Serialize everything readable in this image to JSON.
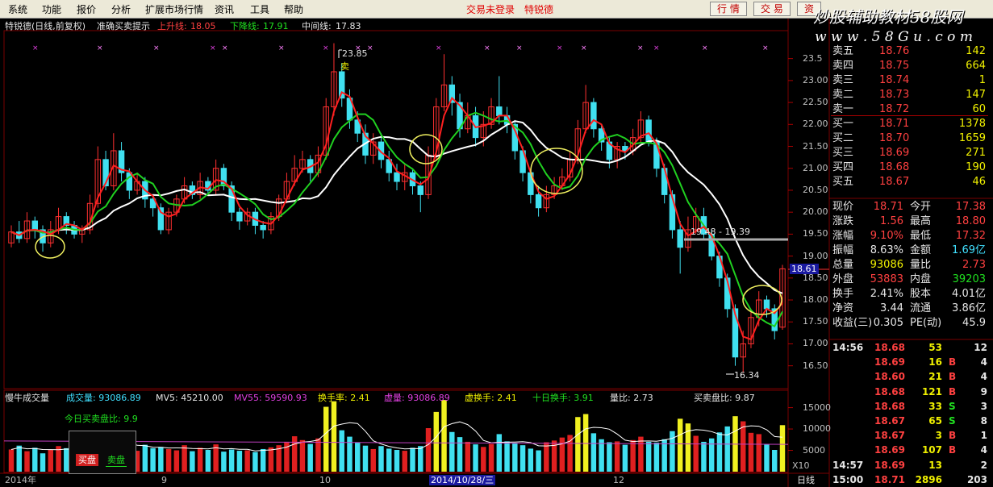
{
  "menu": {
    "items": [
      "系统",
      "功能",
      "报价",
      "分析",
      "扩展市场行情",
      "资讯",
      "工具",
      "帮助"
    ],
    "status": [
      "交易未登录",
      "特锐德"
    ],
    "buttons": [
      "行 情",
      "交 易",
      "资"
    ]
  },
  "watermark": {
    "line1": "炒股辅助教材58股网",
    "line2": "w w w . 5 8 G u . c o m"
  },
  "main_header": {
    "stock": "特锐德(日线,前复权)",
    "indicator": "准确买卖提示",
    "upper_label": "上升线:",
    "upper_value": "18.05",
    "lower_label": "下降线:",
    "lower_value": "17.91",
    "mid_label": "中间线:",
    "mid_value": "17.83"
  },
  "annotations": {
    "high": "23.85",
    "low": "16.34",
    "band": "19.48 - 19.39",
    "sell_signal": "卖",
    "current_price_tag": "18.61",
    "date_cursor": "2014/10/28/三",
    "period": "日线",
    "scale": "X10"
  },
  "price_axis": [
    "23.5",
    "23.00",
    "22.50",
    "22.00",
    "21.50",
    "21.00",
    "20.50",
    "20.00",
    "19.50",
    "19.00",
    "18.50",
    "18.00",
    "17.50",
    "17.00",
    "16.50"
  ],
  "volume_axis": [
    "15000",
    "10000",
    "5000"
  ],
  "date_axis": [
    "2014年",
    "9",
    "10",
    "12"
  ],
  "volume_header": {
    "name": "慢牛成交量",
    "vol": "成交量: 93086.89",
    "mv5": "MV5: 45210.00",
    "mv55": "MV55: 59590.93",
    "turnover": "换手率: 2.41",
    "virtual_vol": "虚量: 93086.89",
    "virtual_turn": "虚换手: 2.41",
    "ten_day": "十日换手: 3.91",
    "vol_ratio": "量比: 2.73",
    "bs_ratio": "买卖盘比: 9.87",
    "today_ratio": "今日买卖盘比: 9.9",
    "buy_btn": "买盘",
    "sell_btn": "卖盘"
  },
  "order_book": [
    {
      "label": "卖五",
      "price": "18.76",
      "qty": "142"
    },
    {
      "label": "卖四",
      "price": "18.75",
      "qty": "664"
    },
    {
      "label": "卖三",
      "price": "18.74",
      "qty": "1"
    },
    {
      "label": "卖二",
      "price": "18.73",
      "qty": "147"
    },
    {
      "label": "卖一",
      "price": "18.72",
      "qty": "60"
    },
    {
      "label": "买一",
      "price": "18.71",
      "qty": "1378"
    },
    {
      "label": "买二",
      "price": "18.70",
      "qty": "1659"
    },
    {
      "label": "买三",
      "price": "18.69",
      "qty": "271"
    },
    {
      "label": "买四",
      "price": "18.68",
      "qty": "190"
    },
    {
      "label": "买五",
      "price": "18.67",
      "qty": "46"
    }
  ],
  "quote": [
    {
      "l1": "现价",
      "v1": "18.71",
      "l2": "今开",
      "v2": "17.38"
    },
    {
      "l1": "涨跌",
      "v1": "1.56",
      "l2": "最高",
      "v2": "18.80"
    },
    {
      "l1": "涨幅",
      "v1": "9.10%",
      "l2": "最低",
      "v2": "17.32"
    },
    {
      "l1": "振幅",
      "v1": "8.63%",
      "l2": "金额",
      "v2": "1.69亿"
    },
    {
      "l1": "总量",
      "v1": "93086",
      "l2": "量比",
      "v2": "2.73"
    },
    {
      "l1": "外盘",
      "v1": "53883",
      "l2": "内盘",
      "v2": "39203"
    },
    {
      "l1": "换手",
      "v1": "2.41%",
      "l2": "股本",
      "v2": "4.01亿"
    },
    {
      "l1": "净资",
      "v1": "3.44",
      "l2": "流通",
      "v2": "3.86亿"
    },
    {
      "l1": "收益(三)",
      "v1": "0.305",
      "l2": "PE(动)",
      "v2": "45.9"
    }
  ],
  "ticks": [
    {
      "time": "14:56",
      "price": "18.68",
      "qty": "53",
      "flag": "",
      "n": "12"
    },
    {
      "time": "",
      "price": "18.69",
      "qty": "16",
      "flag": "B",
      "n": "4"
    },
    {
      "time": "",
      "price": "18.60",
      "qty": "21",
      "flag": "B",
      "n": "4"
    },
    {
      "time": "",
      "price": "18.68",
      "qty": "121",
      "flag": "B",
      "n": "9"
    },
    {
      "time": "",
      "price": "18.68",
      "qty": "33",
      "flag": "S",
      "n": "3"
    },
    {
      "time": "",
      "price": "18.67",
      "qty": "65",
      "flag": "S",
      "n": "8"
    },
    {
      "time": "",
      "price": "18.67",
      "qty": "3",
      "flag": "B",
      "n": "1"
    },
    {
      "time": "",
      "price": "18.69",
      "qty": "107",
      "flag": "B",
      "n": "4"
    },
    {
      "time": "14:57",
      "price": "18.69",
      "qty": "13",
      "flag": "",
      "n": "2"
    },
    {
      "time": "15:00",
      "price": "18.71",
      "qty": "2896",
      "flag": "",
      "n": "203"
    }
  ],
  "chart_data": {
    "type": "candlestick",
    "title": "特锐德(日线,前复权)",
    "price_range": [
      16.2,
      24.1
    ],
    "volume_range": [
      0,
      17000
    ],
    "candles": [
      {
        "o": 19.3,
        "c": 19.55,
        "h": 19.7,
        "l": 19.2
      },
      {
        "o": 19.55,
        "c": 19.4,
        "h": 19.8,
        "l": 19.3
      },
      {
        "o": 19.4,
        "c": 19.8,
        "h": 20.0,
        "l": 19.3
      },
      {
        "o": 19.8,
        "c": 19.6,
        "h": 19.9,
        "l": 19.4
      },
      {
        "o": 19.6,
        "c": 19.3,
        "h": 19.7,
        "l": 19.1
      },
      {
        "o": 19.3,
        "c": 19.6,
        "h": 19.8,
        "l": 19.2
      },
      {
        "o": 19.6,
        "c": 19.9,
        "h": 20.1,
        "l": 19.5
      },
      {
        "o": 19.9,
        "c": 19.7,
        "h": 20.0,
        "l": 19.5
      },
      {
        "o": 19.7,
        "c": 19.5,
        "h": 19.8,
        "l": 19.4
      },
      {
        "o": 19.5,
        "c": 19.6,
        "h": 19.7,
        "l": 19.3
      },
      {
        "o": 19.6,
        "c": 20.2,
        "h": 20.4,
        "l": 19.5
      },
      {
        "o": 20.2,
        "c": 21.2,
        "h": 21.5,
        "l": 20.1
      },
      {
        "o": 21.2,
        "c": 20.6,
        "h": 21.4,
        "l": 20.5
      },
      {
        "o": 20.6,
        "c": 21.4,
        "h": 21.8,
        "l": 20.5
      },
      {
        "o": 21.4,
        "c": 20.9,
        "h": 21.6,
        "l": 20.7
      },
      {
        "o": 20.9,
        "c": 20.5,
        "h": 21.0,
        "l": 20.3
      },
      {
        "o": 20.5,
        "c": 20.7,
        "h": 20.9,
        "l": 20.4
      },
      {
        "o": 20.7,
        "c": 20.3,
        "h": 20.8,
        "l": 20.1
      },
      {
        "o": 20.3,
        "c": 20.1,
        "h": 20.4,
        "l": 19.9
      },
      {
        "o": 20.1,
        "c": 19.6,
        "h": 20.2,
        "l": 19.5
      },
      {
        "o": 19.6,
        "c": 20.0,
        "h": 20.1,
        "l": 19.5
      },
      {
        "o": 20.0,
        "c": 20.3,
        "h": 20.4,
        "l": 19.9
      },
      {
        "o": 20.3,
        "c": 20.6,
        "h": 20.8,
        "l": 20.2
      },
      {
        "o": 20.6,
        "c": 20.4,
        "h": 20.7,
        "l": 20.3
      },
      {
        "o": 20.4,
        "c": 20.7,
        "h": 20.9,
        "l": 20.3
      },
      {
        "o": 20.7,
        "c": 20.5,
        "h": 20.8,
        "l": 20.4
      },
      {
        "o": 20.5,
        "c": 21.0,
        "h": 21.2,
        "l": 20.4
      },
      {
        "o": 21.0,
        "c": 20.6,
        "h": 21.1,
        "l": 20.5
      },
      {
        "o": 20.6,
        "c": 20.0,
        "h": 20.7,
        "l": 19.8
      },
      {
        "o": 20.0,
        "c": 19.8,
        "h": 20.1,
        "l": 19.6
      },
      {
        "o": 19.8,
        "c": 20.0,
        "h": 20.1,
        "l": 19.7
      },
      {
        "o": 20.0,
        "c": 19.7,
        "h": 20.1,
        "l": 19.5
      },
      {
        "o": 19.7,
        "c": 19.6,
        "h": 19.8,
        "l": 19.4
      },
      {
        "o": 19.6,
        "c": 19.9,
        "h": 20.0,
        "l": 19.5
      },
      {
        "o": 19.9,
        "c": 20.3,
        "h": 20.4,
        "l": 19.8
      },
      {
        "o": 20.3,
        "c": 20.7,
        "h": 20.9,
        "l": 20.2
      },
      {
        "o": 20.7,
        "c": 21.0,
        "h": 21.3,
        "l": 20.6
      },
      {
        "o": 21.0,
        "c": 21.2,
        "h": 21.4,
        "l": 20.9
      },
      {
        "o": 21.2,
        "c": 20.9,
        "h": 21.3,
        "l": 20.7
      },
      {
        "o": 20.9,
        "c": 21.3,
        "h": 21.5,
        "l": 20.8
      },
      {
        "o": 21.3,
        "c": 22.4,
        "h": 22.6,
        "l": 21.2
      },
      {
        "o": 22.4,
        "c": 23.2,
        "h": 23.85,
        "l": 22.2
      },
      {
        "o": 23.2,
        "c": 22.6,
        "h": 23.4,
        "l": 22.4
      },
      {
        "o": 22.6,
        "c": 22.1,
        "h": 22.8,
        "l": 21.9
      },
      {
        "o": 22.1,
        "c": 21.8,
        "h": 22.3,
        "l": 21.6
      },
      {
        "o": 21.8,
        "c": 21.3,
        "h": 22.0,
        "l": 21.1
      },
      {
        "o": 21.3,
        "c": 21.6,
        "h": 21.8,
        "l": 21.1
      },
      {
        "o": 21.6,
        "c": 21.2,
        "h": 21.8,
        "l": 21.0
      },
      {
        "o": 21.2,
        "c": 20.9,
        "h": 21.4,
        "l": 20.7
      },
      {
        "o": 20.9,
        "c": 20.7,
        "h": 21.1,
        "l": 20.5
      },
      {
        "o": 20.7,
        "c": 20.9,
        "h": 21.1,
        "l": 20.5
      },
      {
        "o": 20.9,
        "c": 20.6,
        "h": 21.0,
        "l": 20.4
      },
      {
        "o": 20.6,
        "c": 20.4,
        "h": 20.7,
        "l": 20.0
      },
      {
        "o": 20.4,
        "c": 21.3,
        "h": 21.5,
        "l": 20.3
      },
      {
        "o": 21.3,
        "c": 22.4,
        "h": 22.6,
        "l": 21.2
      },
      {
        "o": 22.4,
        "c": 22.9,
        "h": 23.6,
        "l": 22.3
      },
      {
        "o": 22.9,
        "c": 22.5,
        "h": 23.1,
        "l": 22.2
      },
      {
        "o": 22.5,
        "c": 21.9,
        "h": 22.7,
        "l": 21.7
      },
      {
        "o": 21.9,
        "c": 22.2,
        "h": 22.5,
        "l": 21.8
      },
      {
        "o": 22.2,
        "c": 21.7,
        "h": 22.4,
        "l": 21.5
      },
      {
        "o": 21.7,
        "c": 22.0,
        "h": 22.3,
        "l": 21.5
      },
      {
        "o": 22.0,
        "c": 22.4,
        "h": 22.6,
        "l": 21.9
      },
      {
        "o": 22.4,
        "c": 22.2,
        "h": 23.1,
        "l": 22.0
      },
      {
        "o": 22.2,
        "c": 22.0,
        "h": 22.4,
        "l": 21.8
      },
      {
        "o": 22.0,
        "c": 21.4,
        "h": 22.1,
        "l": 21.2
      },
      {
        "o": 21.4,
        "c": 20.9,
        "h": 21.5,
        "l": 20.7
      },
      {
        "o": 20.9,
        "c": 20.4,
        "h": 21.0,
        "l": 20.2
      },
      {
        "o": 20.4,
        "c": 20.1,
        "h": 20.6,
        "l": 19.9
      },
      {
        "o": 20.1,
        "c": 20.4,
        "h": 20.6,
        "l": 20.0
      },
      {
        "o": 20.4,
        "c": 20.6,
        "h": 20.8,
        "l": 20.3
      },
      {
        "o": 20.6,
        "c": 20.8,
        "h": 21.0,
        "l": 20.5
      },
      {
        "o": 20.8,
        "c": 21.2,
        "h": 21.4,
        "l": 20.7
      },
      {
        "o": 21.2,
        "c": 21.9,
        "h": 22.1,
        "l": 21.1
      },
      {
        "o": 21.9,
        "c": 22.5,
        "h": 22.9,
        "l": 21.8
      },
      {
        "o": 22.5,
        "c": 21.9,
        "h": 22.6,
        "l": 21.7
      },
      {
        "o": 21.9,
        "c": 21.6,
        "h": 22.0,
        "l": 21.4
      },
      {
        "o": 21.6,
        "c": 21.2,
        "h": 21.7,
        "l": 21.0
      },
      {
        "o": 21.2,
        "c": 21.5,
        "h": 21.6,
        "l": 21.0
      },
      {
        "o": 21.5,
        "c": 21.4,
        "h": 21.6,
        "l": 21.2
      },
      {
        "o": 21.4,
        "c": 21.7,
        "h": 21.9,
        "l": 21.3
      },
      {
        "o": 21.7,
        "c": 22.1,
        "h": 22.3,
        "l": 21.6
      },
      {
        "o": 22.1,
        "c": 21.6,
        "h": 22.2,
        "l": 21.5
      },
      {
        "o": 21.6,
        "c": 21.0,
        "h": 21.7,
        "l": 20.8
      },
      {
        "o": 21.0,
        "c": 20.4,
        "h": 21.1,
        "l": 20.2
      },
      {
        "o": 20.4,
        "c": 19.6,
        "h": 20.5,
        "l": 19.4
      },
      {
        "o": 19.6,
        "c": 19.2,
        "h": 19.8,
        "l": 18.6
      },
      {
        "o": 19.2,
        "c": 19.6,
        "h": 19.9,
        "l": 19.1
      },
      {
        "o": 19.6,
        "c": 19.9,
        "h": 20.1,
        "l": 19.5
      },
      {
        "o": 19.9,
        "c": 19.5,
        "h": 20.1,
        "l": 19.4
      },
      {
        "o": 19.5,
        "c": 19.0,
        "h": 19.6,
        "l": 18.9
      },
      {
        "o": 19.0,
        "c": 18.5,
        "h": 19.1,
        "l": 18.3
      },
      {
        "o": 18.5,
        "c": 17.8,
        "h": 18.6,
        "l": 17.6
      },
      {
        "o": 17.8,
        "c": 16.7,
        "h": 17.9,
        "l": 16.5
      },
      {
        "o": 16.7,
        "c": 17.0,
        "h": 17.3,
        "l": 16.34
      },
      {
        "o": 17.0,
        "c": 17.6,
        "h": 17.8,
        "l": 16.9
      },
      {
        "o": 17.6,
        "c": 18.0,
        "h": 18.2,
        "l": 17.4
      },
      {
        "o": 18.0,
        "c": 17.8,
        "h": 18.1,
        "l": 17.6
      },
      {
        "o": 17.8,
        "c": 17.3,
        "h": 17.9,
        "l": 17.1
      },
      {
        "o": 17.38,
        "c": 18.71,
        "h": 18.8,
        "l": 17.32
      }
    ],
    "volumes": [
      5200,
      6100,
      4800,
      5600,
      4300,
      5100,
      6000,
      5500,
      4700,
      5000,
      7600,
      9000,
      6800,
      7200,
      5900,
      6100,
      4900,
      6300,
      5500,
      5800,
      5300,
      5000,
      6200,
      4800,
      5600,
      5100,
      6400,
      4700,
      5200,
      4900,
      5000,
      4600,
      5300,
      5700,
      6200,
      7000,
      8300,
      7400,
      6500,
      7800,
      15200,
      16500,
      9700,
      8200,
      6900,
      6100,
      5300,
      6000,
      5400,
      5100,
      4900,
      5600,
      6000,
      10200,
      14000,
      16800,
      9300,
      8100,
      7000,
      6400,
      5800,
      6500,
      8800,
      7100,
      6600,
      6200,
      5400,
      5000,
      6900,
      7300,
      8000,
      8600,
      12800,
      13500,
      9000,
      7600,
      6900,
      7100,
      6300,
      7400,
      8200,
      7000,
      6800,
      7600,
      9500,
      12400,
      11300,
      8400,
      7000,
      7800,
      9200,
      10600,
      13000,
      11800,
      9100,
      8800,
      6400,
      5100,
      10900
    ],
    "upper_line": [],
    "series": [
      {
        "name": "上升线",
        "value": "18.05"
      },
      {
        "name": "下降线",
        "value": "17.91"
      },
      {
        "name": "中间线",
        "value": "17.83"
      }
    ]
  }
}
